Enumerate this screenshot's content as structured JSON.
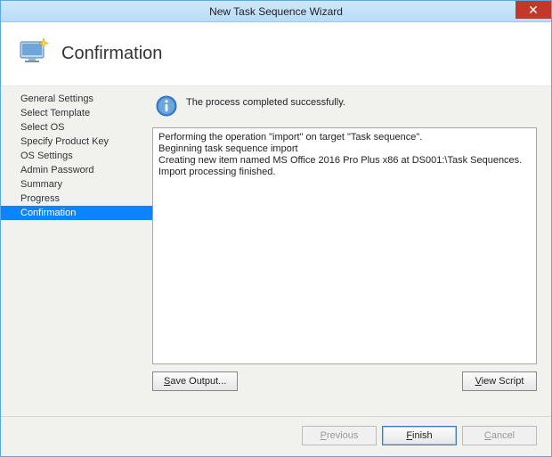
{
  "window": {
    "title": "New Task Sequence Wizard",
    "close": "✕"
  },
  "header": {
    "title": "Confirmation"
  },
  "sidebar": {
    "steps": [
      "General Settings",
      "Select Template",
      "Select OS",
      "Specify Product Key",
      "OS Settings",
      "Admin Password",
      "Summary",
      "Progress",
      "Confirmation"
    ],
    "active_index": 8
  },
  "status": {
    "message": "The process completed successfully."
  },
  "log": {
    "lines": [
      "Performing the operation \"import\" on target \"Task sequence\".",
      "Beginning task sequence import",
      "Creating new item named MS Office 2016 Pro Plus x86 at DS001:\\Task Sequences.",
      "Import processing finished."
    ]
  },
  "buttons": {
    "save_output": "Save Output...",
    "view_script": "View Script",
    "previous": "Previous",
    "finish": "Finish",
    "cancel": "Cancel"
  }
}
